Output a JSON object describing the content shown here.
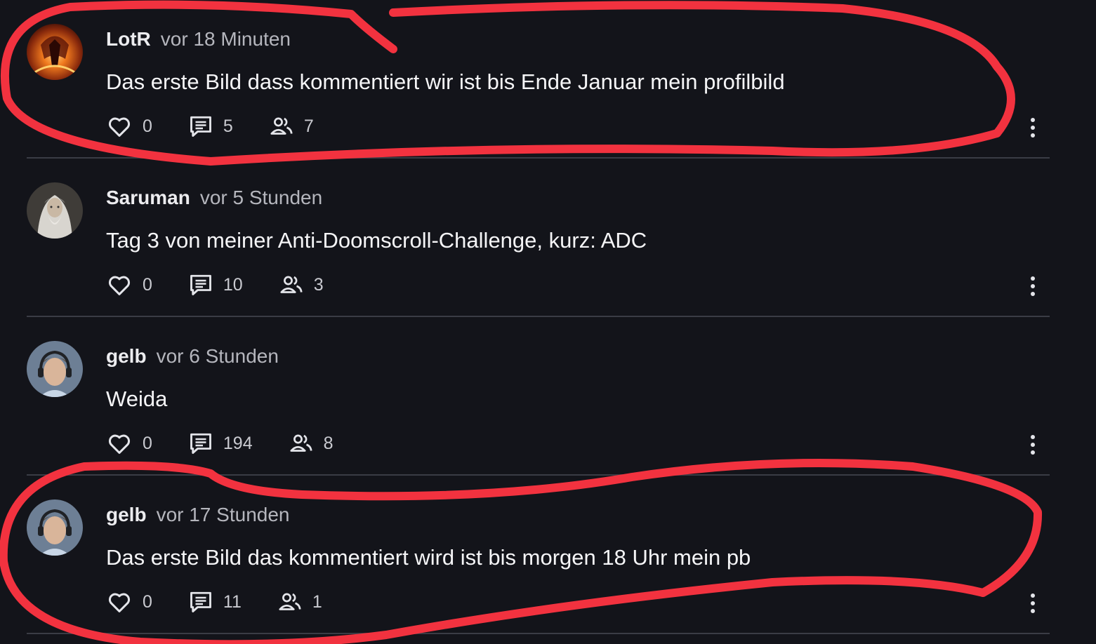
{
  "posts": [
    {
      "author": "LotR",
      "time": "vor 18 Minuten",
      "text": "Das erste Bild dass kommentiert wir ist bis Ende Januar mein profilbild",
      "likes": "0",
      "comments": "5",
      "participants": "7",
      "avatar": "balrog-avatar"
    },
    {
      "author": "Saruman",
      "time": "vor 5 Stunden",
      "text": "Tag 3 von meiner Anti-Doomscroll-Challenge, kurz: ADC",
      "likes": "0",
      "comments": "10",
      "participants": "3",
      "avatar": "wizard-avatar"
    },
    {
      "author": "gelb",
      "time": "vor 6 Stunden",
      "text": "Weida",
      "likes": "0",
      "comments": "194",
      "participants": "8",
      "avatar": "person-headphones-avatar"
    },
    {
      "author": "gelb",
      "time": "vor 17 Stunden",
      "text": "Das erste Bild das kommentiert wird ist bis morgen 18 Uhr mein pb",
      "likes": "0",
      "comments": "11",
      "participants": "1",
      "avatar": "person-headphones-avatar"
    }
  ],
  "icons": {
    "like": "heart-icon",
    "comment": "comment-icon",
    "participants": "people-icon",
    "more": "more-vertical-icon"
  },
  "colors": {
    "background": "#13141a",
    "divider": "#3a3c45",
    "annotation": "#f2323f",
    "text": "#f5f5f7",
    "muted": "#b5b6bd"
  }
}
